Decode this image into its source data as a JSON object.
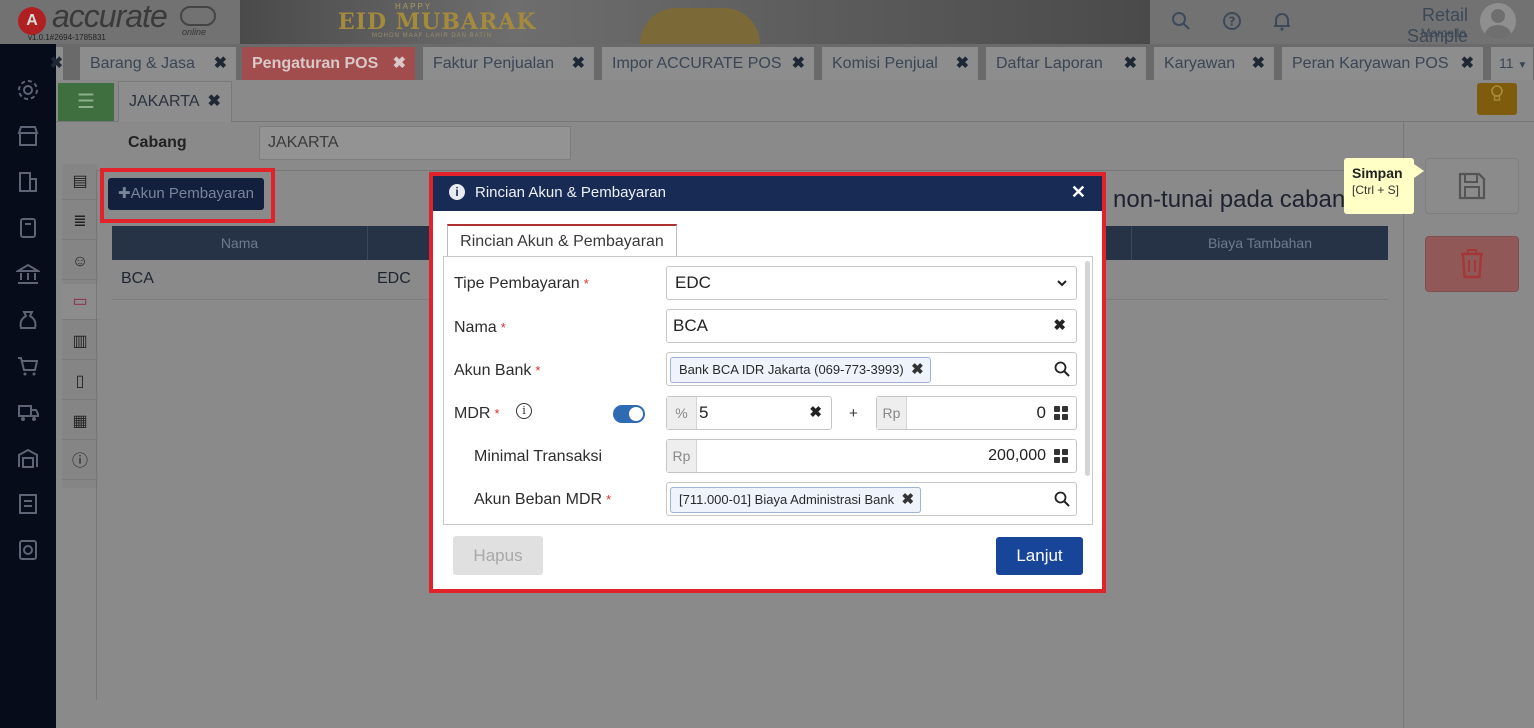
{
  "app": {
    "logo_mark": "A",
    "logo_text": "accurate",
    "logo_suffix": "online",
    "version": "v1.0.1#2694-1785831",
    "banner_top": "HAPPY",
    "banner_title": "EID MUBARAK",
    "banner_subtitle": "MOHON MAAF LAHIR DAN BATIN",
    "user_name": "Retail Sample",
    "user_sub": "Marcello"
  },
  "tabs": [
    {
      "label": "Barang & Jasa",
      "active": false
    },
    {
      "label": "Pengaturan POS",
      "active": true
    },
    {
      "label": "Faktur Penjualan",
      "active": false
    },
    {
      "label": "Impor ACCURATE POS",
      "active": false
    },
    {
      "label": "Komisi Penjual",
      "active": false
    },
    {
      "label": "Daftar Laporan",
      "active": false
    },
    {
      "label": "Karyawan",
      "active": false
    },
    {
      "label": "Peran Karyawan POS",
      "active": false
    }
  ],
  "tab_close": "✖",
  "tab_overflow": "11",
  "subtab": {
    "label": "JAKARTA",
    "close": "✖"
  },
  "cabang": {
    "label": "Cabang",
    "value": "JAKARTA"
  },
  "akun_button": "✚Akun Pembayaran",
  "info_text": "non-tunai pada cabang",
  "table": {
    "headers": [
      "Nama",
      "",
      "",
      "",
      "Biaya Tambahan"
    ],
    "rows": [
      {
        "nama": "BCA",
        "tipe": "EDC"
      }
    ]
  },
  "tooltip": {
    "title": "Simpan",
    "shortcut": "[Ctrl + S]"
  },
  "modal": {
    "title": "Rincian Akun & Pembayaran",
    "close": "✕",
    "tab_label": "Rincian Akun & Pembayaran",
    "fields": {
      "tipe": {
        "label": "Tipe Pembayaran",
        "value": "EDC"
      },
      "nama": {
        "label": "Nama",
        "value": "BCA"
      },
      "akun_bank": {
        "label": "Akun Bank",
        "chip": "Bank BCA IDR Jakarta (069-773-3993)"
      },
      "mdr": {
        "label": "MDR",
        "percent_prefix": "%",
        "percent_value": "5",
        "plus": "+",
        "rp_prefix": "Rp",
        "rp_value": "0",
        "enabled": true
      },
      "minimal": {
        "label": "Minimal Transaksi",
        "prefix": "Rp",
        "value": "200,000"
      },
      "akun_beban": {
        "label": "Akun Beban MDR",
        "chip": "[711.000-01] Biaya Administrasi Bank"
      }
    },
    "required_mark": "*",
    "hapus": "Hapus",
    "lanjut": "Lanjut"
  },
  "colors": {
    "highlight": "#e0232b",
    "modal_header": "#172b54",
    "primary": "#17459a",
    "active_tab": "#a24d4d"
  },
  "icons": {
    "sidebar": [
      "gear-icon",
      "store-icon",
      "building-icon",
      "book-icon",
      "bank-icon",
      "money-bag-icon",
      "cart-icon",
      "cart-truck-icon",
      "warehouse-icon",
      "tax-icon",
      "report-icon"
    ],
    "inner": [
      "doc-search-icon",
      "stack-icon",
      "people-icon",
      "payment-icon",
      "receipt-icon",
      "tablet-icon",
      "printer-icon",
      "info-icon"
    ]
  }
}
